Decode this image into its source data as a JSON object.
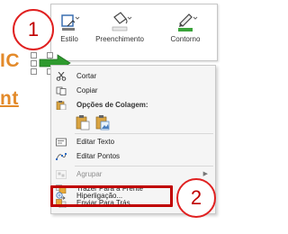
{
  "background": {
    "line1": "IC",
    "line2": "nt"
  },
  "callouts": {
    "first": "1",
    "second": "2"
  },
  "toolbar": {
    "estilo": "Estilo",
    "preenchimento": "Preenchimento",
    "contorno": "Contorno"
  },
  "menu": {
    "cortar": "Cortar",
    "copiar": "Copiar",
    "opcoes_colagem": "Opções de Colagem:",
    "editar_texto": "Editar Texto",
    "editar_pontos": "Editar Pontos",
    "agrupar": "Agrupar",
    "trazer_frente": "Trazer Para a Frente",
    "enviar_tras": "Enviar Para Trás",
    "hiperligacao": "Hiperligação..."
  },
  "colors": {
    "accent_orange": "#e38a2a",
    "callout_red": "#c00000",
    "arrow_green": "#2e9a2e"
  }
}
